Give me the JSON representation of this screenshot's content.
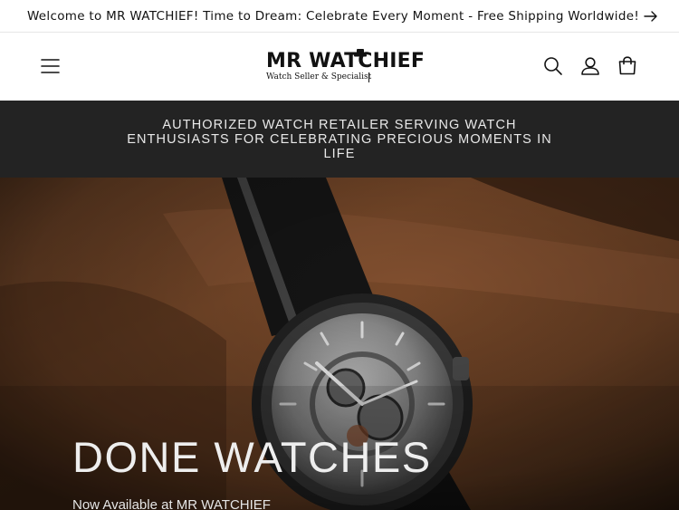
{
  "announcement": {
    "text": "Welcome to MR WATCHIEF! Time to Dream: Celebrate Every Moment - Free Shipping Worldwide!",
    "arrow_icon": "arrow-right-icon"
  },
  "header": {
    "menu_icon": "hamburger-menu-icon",
    "logo": {
      "name": "MR WATCHIEF",
      "tagline": "Watch Seller & Specialist"
    },
    "icons": [
      "search-icon",
      "account-icon",
      "cart-icon"
    ]
  },
  "banner": {
    "text": "AUTHORIZED WATCH RETAILER SERVING WATCH ENTHUSIASTS FOR CELEBRATING PRECIOUS MOMENTS IN LIFE"
  },
  "hero": {
    "title": "DONE WATCHES",
    "subtitle": "Now Available at MR WATCHIEF"
  },
  "colors": {
    "banner_bg": "#232323",
    "text": "#121212",
    "leather": "#7a4a2a"
  }
}
